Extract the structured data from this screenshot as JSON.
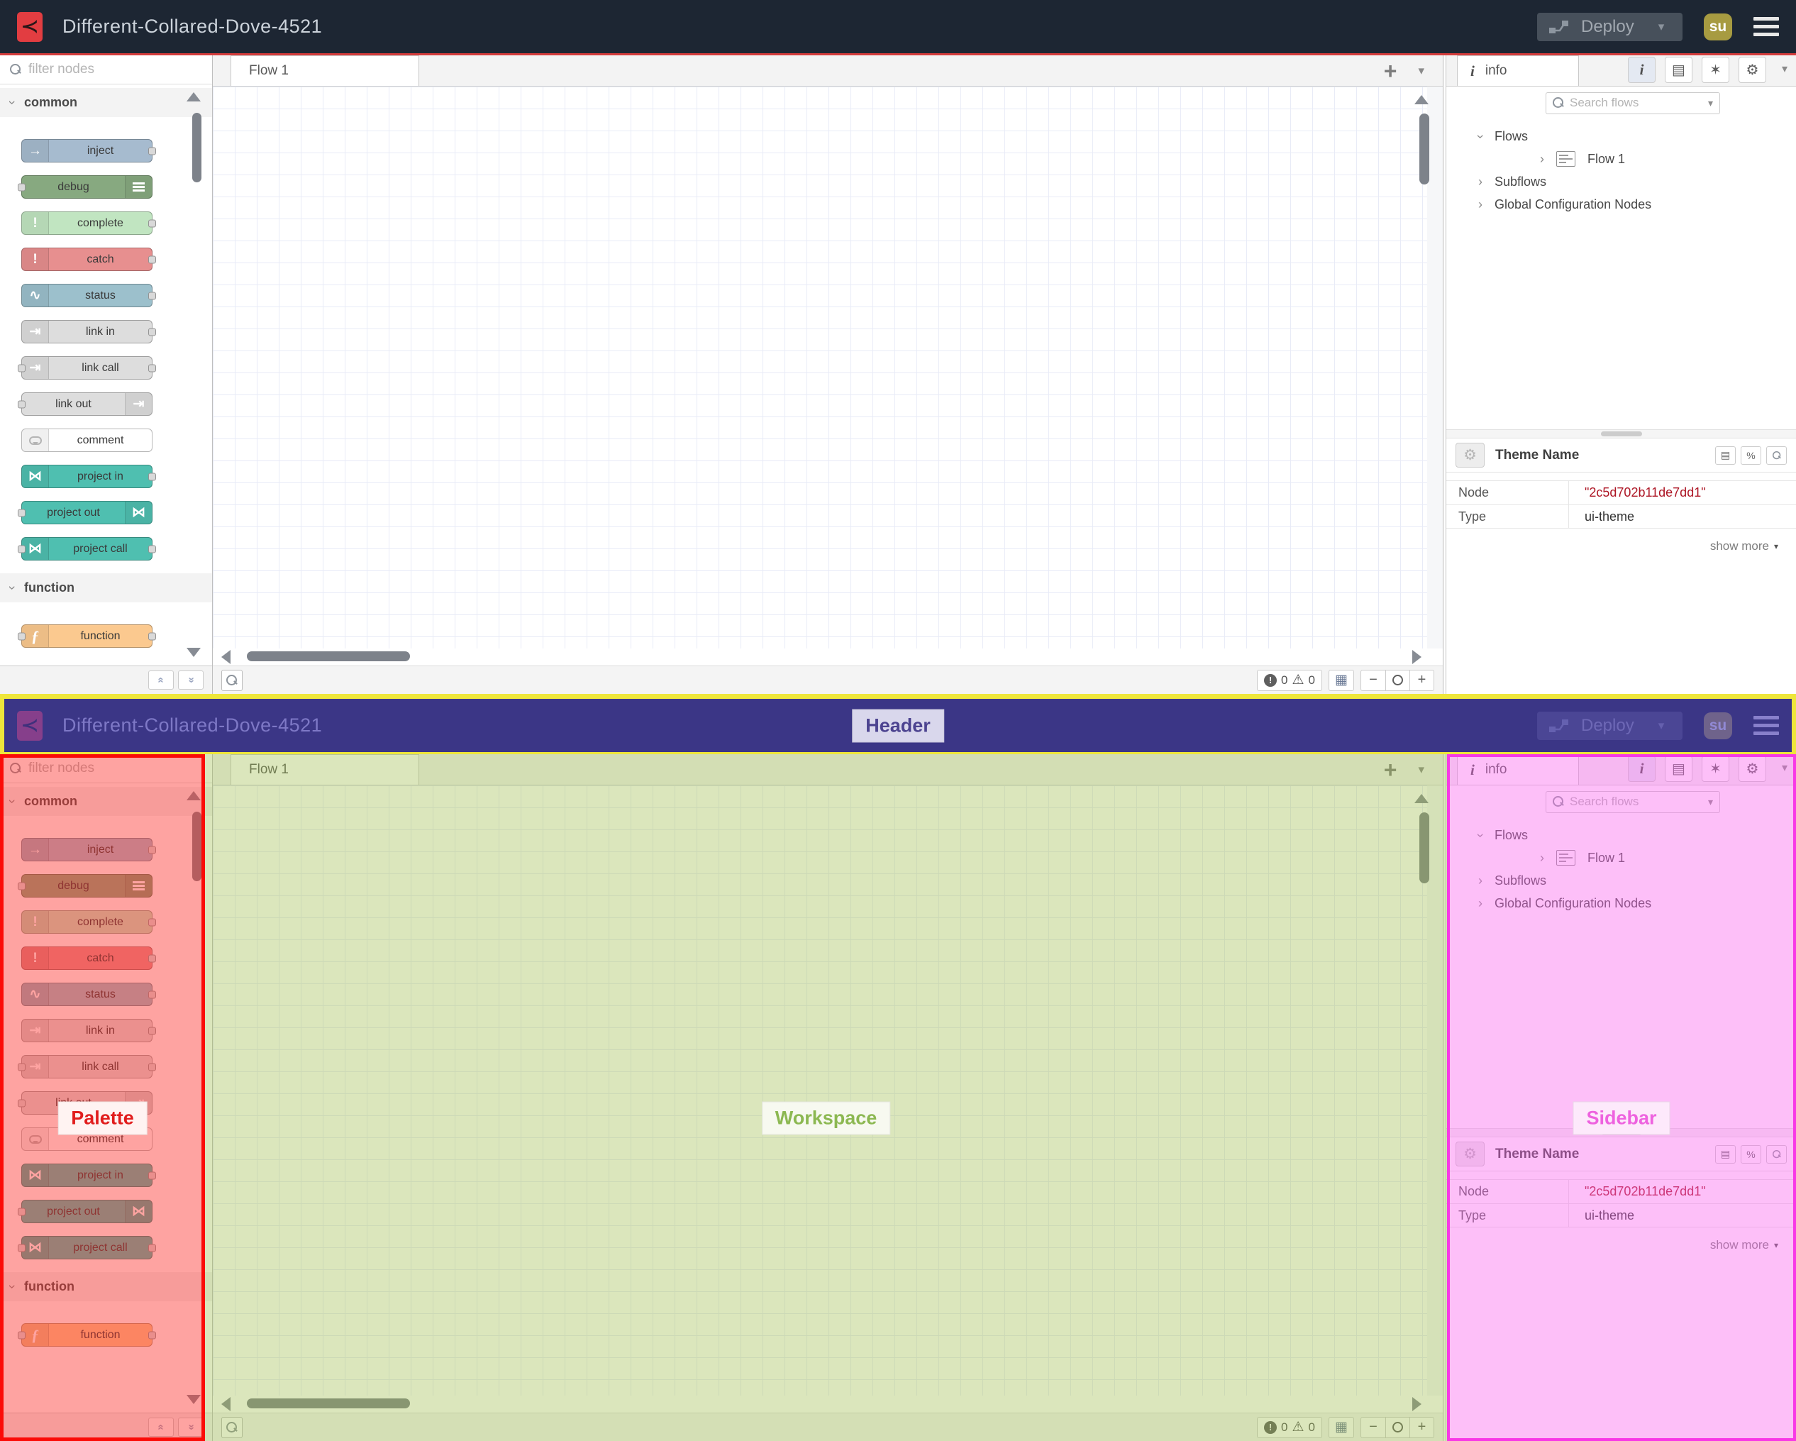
{
  "header": {
    "title": "Different-Collared-Dove-4521",
    "deploy_label": "Deploy",
    "avatar_initials": "su"
  },
  "palette": {
    "filter_placeholder": "filter nodes",
    "categories": [
      {
        "label": "common",
        "nodes": [
          {
            "label": "inject",
            "color": "#a6bbcf",
            "icon": "arrow-right-icon",
            "icon_side": "left",
            "port_in": false,
            "port_out": true
          },
          {
            "label": "debug",
            "color": "#87a980",
            "icon": "list-icon",
            "icon_side": "right",
            "port_in": true,
            "port_out": false
          },
          {
            "label": "complete",
            "color": "#c1e5c1",
            "icon": "exclamation-icon",
            "icon_side": "left",
            "port_in": false,
            "port_out": true
          },
          {
            "label": "catch",
            "color": "#e78f8f",
            "icon": "exclamation-icon",
            "icon_side": "left",
            "port_in": false,
            "port_out": true
          },
          {
            "label": "status",
            "color": "#9cc0cc",
            "icon": "pulse-icon",
            "icon_side": "left",
            "port_in": false,
            "port_out": true
          },
          {
            "label": "link in",
            "color": "#dddddd",
            "icon": "link-icon",
            "icon_side": "left",
            "port_in": false,
            "port_out": true
          },
          {
            "label": "link call",
            "color": "#dddddd",
            "icon": "link-icon",
            "icon_side": "left",
            "port_in": true,
            "port_out": true
          },
          {
            "label": "link out",
            "color": "#dddddd",
            "icon": "link-icon",
            "icon_side": "right",
            "port_in": true,
            "port_out": false
          },
          {
            "label": "comment",
            "color": "#ffffff",
            "icon": "comment-icon",
            "icon_side": "left",
            "port_in": false,
            "port_out": false
          },
          {
            "label": "project in",
            "color": "#4fbfb0",
            "icon": "project-icon",
            "icon_side": "left",
            "port_in": false,
            "port_out": true
          },
          {
            "label": "project out",
            "color": "#4fbfb0",
            "icon": "project-icon",
            "icon_side": "right",
            "port_in": true,
            "port_out": false
          },
          {
            "label": "project call",
            "color": "#4fbfb0",
            "icon": "project-icon",
            "icon_side": "left",
            "port_in": true,
            "port_out": true
          }
        ]
      },
      {
        "label": "function",
        "nodes": [
          {
            "label": "function",
            "color": "#fbc98f",
            "icon": "function-icon",
            "icon_side": "left",
            "port_in": true,
            "port_out": true
          }
        ]
      }
    ]
  },
  "workspace": {
    "tab_label": "Flow 1",
    "error_count": "0",
    "warning_count": "0"
  },
  "sidebar": {
    "tab_label": "info",
    "search_placeholder": "Search flows",
    "tree": {
      "flows": "Flows",
      "flow1": "Flow 1",
      "subflows": "Subflows",
      "global_config": "Global Configuration Nodes"
    },
    "panel": {
      "title": "Theme Name",
      "node_label": "Node",
      "node_value": "\"2c5d702b11de7dd1\"",
      "node_value_color": "#ad1625",
      "type_label": "Type",
      "type_value": "ui-theme",
      "show_more": "show more"
    }
  },
  "annotations": {
    "divider_color": "#eee63b",
    "header": {
      "label": "Header",
      "fill": "rgba(78,64,185,0.62)",
      "border": "#eee63b",
      "label_color": "#4c4390",
      "label_bg": "#d9d7ec"
    },
    "palette": {
      "label": "Palette",
      "fill": "rgba(253,45,40,0.44)",
      "border": "#fb0b07",
      "label_color": "#e11d1d",
      "label_bg": "#fff3f2"
    },
    "workspace": {
      "label": "Workspace",
      "fill": "rgba(156,186,70,0.36)",
      "border": "#9cba46",
      "label_color": "#8cb852",
      "label_bg": "#f7f9f0"
    },
    "sidebar": {
      "label": "Sidebar",
      "fill": "rgba(250,103,238,0.42)",
      "border": "#f838e6",
      "label_color": "#ee62df",
      "label_bg": "#fde9fb"
    }
  }
}
